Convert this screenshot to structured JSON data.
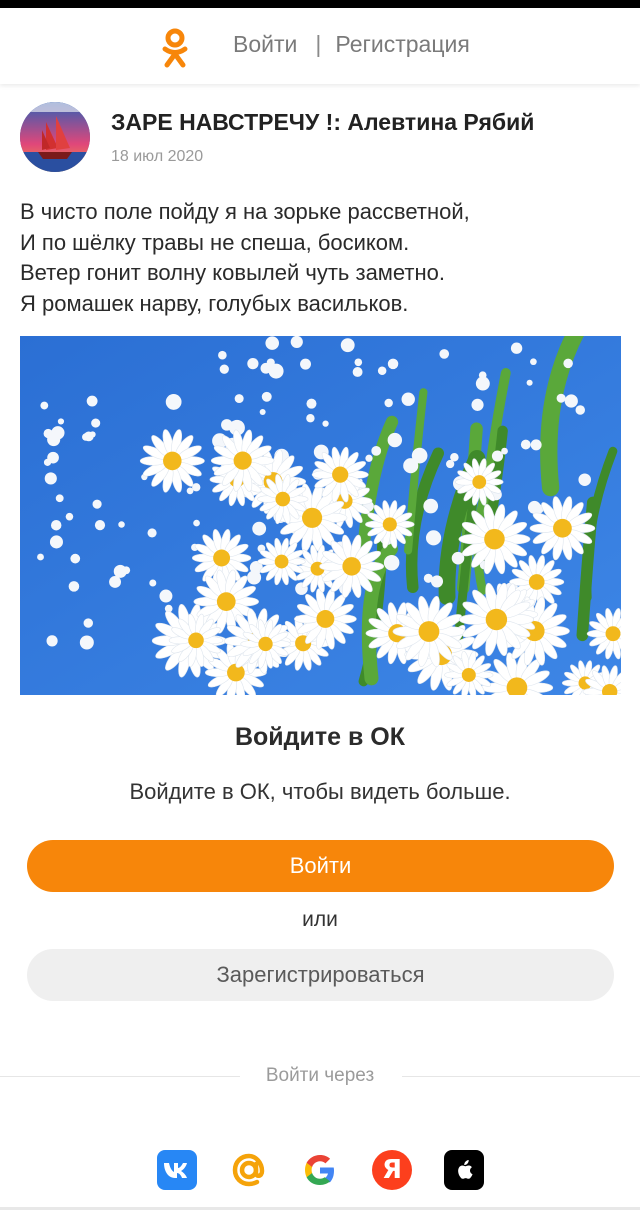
{
  "header": {
    "login_link": "Войти",
    "separator": "|",
    "register_link": "Регистрация"
  },
  "post": {
    "author": "ЗАРЕ НАВСТРЕЧУ !: Алевтина Рябий",
    "date": "18 июл 2020",
    "lines": [
      "В чисто поле пойду я на зорьке рассветной,",
      "И по шёлку травы не спеша, босиком.",
      "Ветер гонит волну ковылей чуть заметно.",
      "Я ромашек нарву, голубых васильков."
    ]
  },
  "login_sheet": {
    "title": "Войдите в ОК",
    "subtitle": "Войдите в ОК, чтобы видеть больше.",
    "login_button": "Войти",
    "or": "или",
    "register_button": "Зарегистрироваться",
    "login_via": "Войти через",
    "providers": [
      "vk-icon",
      "mail-ru-icon",
      "google-icon",
      "yandex-icon",
      "apple-icon"
    ]
  },
  "colors": {
    "accent": "#f7860a",
    "vk": "#2787f5",
    "mail": "#f5a30a",
    "yandex": "#fc3f1d",
    "apple": "#000000"
  }
}
